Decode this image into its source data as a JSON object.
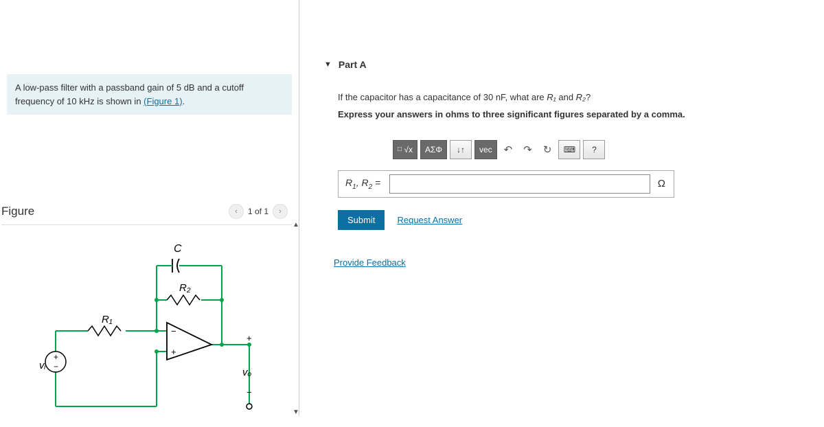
{
  "problem": {
    "prefix": "A low-pass filter with a passband gain of 5 ",
    "unit1": "dB",
    "mid": " and a cutoff frequency of 10 ",
    "unit2": "kHz",
    "suffix": " is shown in ",
    "figlink": "(Figure 1)",
    "end": "."
  },
  "figure": {
    "title": "Figure",
    "counter": "1 of 1",
    "labels": {
      "C": "C",
      "R1": "R₁",
      "R2": "R₂",
      "vi": "vᵢ",
      "vo": "vₒ",
      "plus": "+",
      "minus": "−"
    }
  },
  "part": {
    "label": "Part A",
    "q_prefix": "If the capacitor has a capacitance of 30 ",
    "q_unit": "nF",
    "q_mid": ", what are ",
    "q_r1": "R₁",
    "q_and": " and ",
    "q_r2": "R₂",
    "q_end": "?",
    "instruction": "Express your answers in ohms to three significant figures separated by a comma."
  },
  "toolbar": {
    "templates": "√x",
    "greek": "ΑΣΦ",
    "subscript": "↓↑",
    "vec": "vec",
    "undo": "↶",
    "redo": "↷",
    "reset": "↻",
    "keyboard": "⌨",
    "help": "?"
  },
  "answer": {
    "label_prefix": "R",
    "label_1": "1",
    "label_sep": ", ",
    "label_2": "2",
    "equals": " =",
    "value": "",
    "unit": "Ω"
  },
  "actions": {
    "submit": "Submit",
    "request": "Request Answer",
    "feedback": "Provide Feedback"
  }
}
